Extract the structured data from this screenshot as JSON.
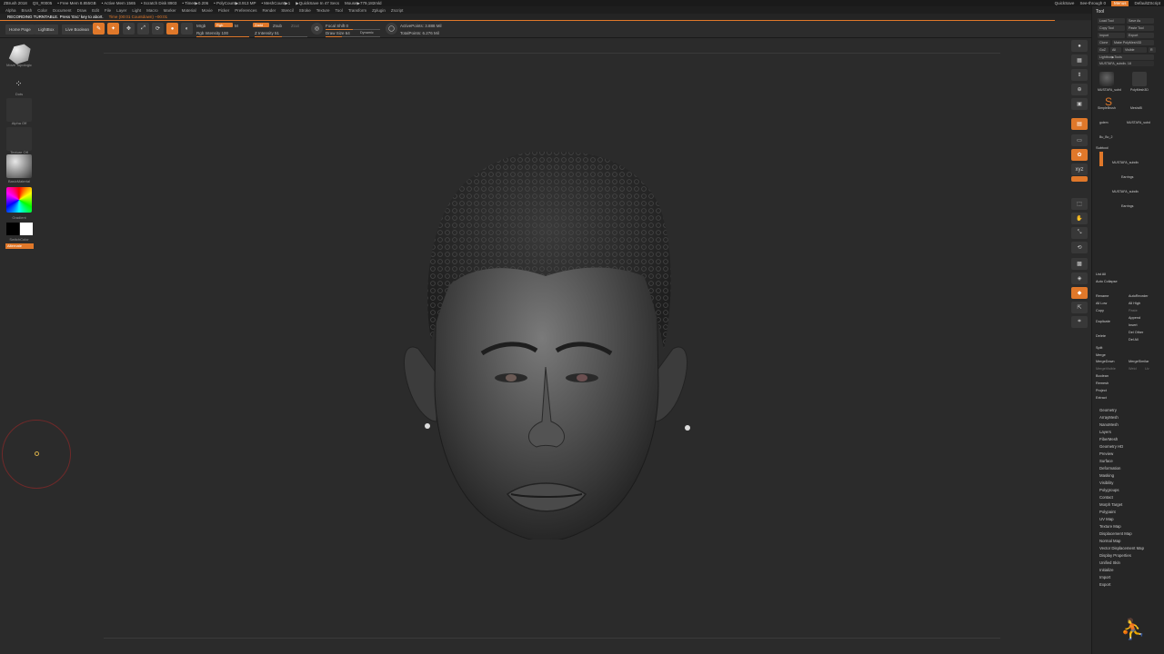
{
  "titlebar": {
    "app": "ZBrush 2018",
    "project": "QS_#0005",
    "stats": [
      "• Free Mem 8.855GB",
      "• Active Mem 1565",
      "• Scratch Disk 8903",
      "• Timer▶0.206",
      "• PolyCount▶3.913 MP",
      "• MeshCount▶1",
      "▶QuickSave In 47 Secs",
      "Mouse▶779,182mld"
    ],
    "quicksave": "QuickSave",
    "see_through": "See-through 0",
    "menus_badge": "Menus",
    "default_script": "DefaultZScript"
  },
  "menubar": [
    "Alpha",
    "Brush",
    "Color",
    "Document",
    "Draw",
    "Edit",
    "File",
    "Layer",
    "Light",
    "Macro",
    "Marker",
    "Material",
    "Movie",
    "Picker",
    "Preferences",
    "Render",
    "Stencil",
    "Stroke",
    "Texture",
    "Tool",
    "Transform",
    "Zplugin",
    "Zscript"
  ],
  "statusbar": {
    "recording": "RECORDING TURNTABLE. Press 'Esc' key to abort.",
    "timer": "Time (00:01 Countdown) ~00:01"
  },
  "shelf": {
    "home_page": "Home Page",
    "lightbox": "LightBox",
    "live_boolean": "Live Boolean",
    "edit": "Edit",
    "draw": "Draw",
    "move": "Move",
    "scale": "Scale",
    "rotate": "Rotate",
    "mrgb": "Mrgb",
    "rgb": "Rgb",
    "m": "M",
    "zadd": "Zadd",
    "zsub": "Zsub",
    "zcut": "Zcut",
    "rgb_intensity": "Rgb Intensity 100",
    "z_intensity": "Z Intensity 51",
    "focal_shift": "Focal Shift 0",
    "draw_size": "Draw Size 64",
    "dynamic": "Dynamic",
    "active_points": "ActivePoints: 3.888 Mil",
    "total_points": "TotalPoints: 6.276 Mil"
  },
  "leftshelf": {
    "brush_caption": "Move Topologic",
    "stroke_caption": "Dots",
    "alpha_caption": "Alpha Off",
    "texture_caption": "Texture Off",
    "material_caption": "BasicMaterial",
    "gradient_caption": "Gradient",
    "switch_caption": "SwitchColor",
    "alternate": "Alternate"
  },
  "tray": {
    "title": "Tool",
    "load_tool": "Load Tool",
    "save_as": "Save As",
    "copy_tool": "Copy Tool",
    "paste_tool": "Paste Tool",
    "import": "Import",
    "export": "Export",
    "clone": "Clone",
    "make_polymesh": "Make PolyMesh3D",
    "goz": "GoZ",
    "all": "All",
    "visible": "Visible",
    "r": "R",
    "lightbox_tools": "Lightbox▶Tools",
    "current_tool": "MUSTAFA_subdiv. 18",
    "tool_thumbs": [
      "MUSTAFA_subd",
      "Cylinder3D",
      "PolyMesh3D",
      "SimpleBrush",
      "MeshdB",
      "golem",
      "MUSTAFA_subd",
      "Bu_Bo_2"
    ],
    "subtool_title": "Subtool",
    "subtools": [
      "MUSTAFA_subdiv",
      "Earrings",
      "MUSTAFA_subdiv",
      "Earrings"
    ],
    "list_all": "List All",
    "auto_collapse": "Auto Collapse",
    "rename": "Rename",
    "autoreorder": "AutoReorder",
    "all_low": "All Low",
    "all_high": "All High",
    "copy": "Copy",
    "paste": "Paste",
    "duplicate": "Duplicate",
    "append": "Append",
    "insert": "Insert",
    "delete": "Delete",
    "del_other": "Del Other",
    "del_all": "Del All",
    "split": "Split",
    "merge": "Merge",
    "merge_down": "MergeDown",
    "merge_similar": "MergeSimilar",
    "merge_visible": "MergeVisible",
    "weld": "Weld",
    "uv": "Uv",
    "boolean": "Boolean",
    "remesh": "Remesh",
    "project": "Project",
    "extract": "Extract",
    "sections": [
      "Geometry",
      "ArrayMesh",
      "NanoMesh",
      "Layers",
      "FiberMesh",
      "Geometry HD",
      "Preview",
      "Surface",
      "Deformation",
      "Masking",
      "Visibility",
      "Polygroups",
      "Contact",
      "Morph Target",
      "Polypaint",
      "UV Map",
      "Texture Map",
      "Displacement Map",
      "Normal Map",
      "Vector Displacement Map",
      "Display Properties",
      "Unified Skin",
      "Initialize",
      "Import",
      "Export"
    ]
  },
  "colors": {
    "accent": "#e0782a",
    "background": "#2b2b2b",
    "panel": "#262626"
  }
}
